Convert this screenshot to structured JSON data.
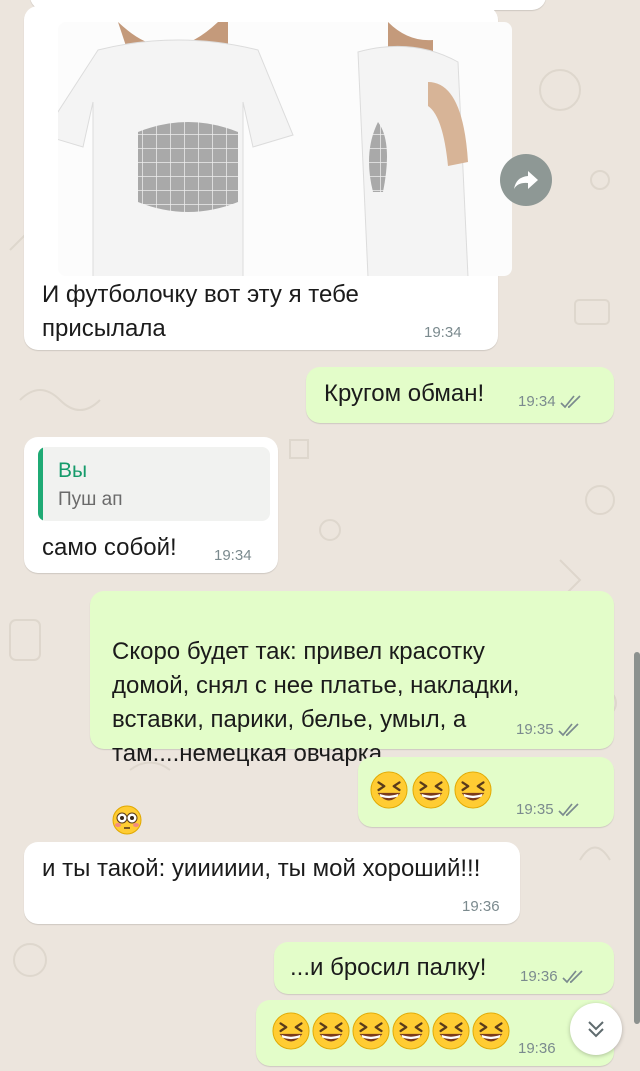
{
  "colors": {
    "background": "#ece5dd",
    "incoming_bubble": "#ffffff",
    "outgoing_bubble": "#e3fdc9",
    "read_ticks": "#7b8a8e",
    "quote_accent": "#1faa74"
  },
  "messages": [
    {
      "id": "m1",
      "direction": "in",
      "type": "image",
      "image": "woman-in-white-t-shirt-with-grid-print",
      "text": "И футболочку вот эту я тебе\nприсылала",
      "time": "19:34"
    },
    {
      "id": "m2",
      "direction": "out",
      "text": "Кругом обман!",
      "time": "19:34",
      "status": "read"
    },
    {
      "id": "m3",
      "direction": "in",
      "reply_to": {
        "author": "Вы",
        "text": "Пуш ап"
      },
      "text": "само собой!",
      "time": "19:34"
    },
    {
      "id": "m4",
      "direction": "out",
      "text": "Скоро будет так: привел красотку\nдомой, снял с нее платье, накладки,\nвставки, парики, белье, умыл, а\nтам....немецкая овчарка",
      "emoji": [
        "flushed-face"
      ],
      "time": "19:35",
      "status": "read"
    },
    {
      "id": "m5",
      "direction": "out",
      "emoji": [
        "laughing-face",
        "laughing-face",
        "laughing-face"
      ],
      "time": "19:35",
      "status": "read"
    },
    {
      "id": "m6",
      "direction": "in",
      "text": "и ты такой: уииииии, ты мой хороший!!!",
      "time": "19:36"
    },
    {
      "id": "m7",
      "direction": "out",
      "text": "...и бросил палку!",
      "time": "19:36",
      "status": "read"
    },
    {
      "id": "m8",
      "direction": "out",
      "emoji": [
        "laughing-face",
        "laughing-face",
        "laughing-face",
        "laughing-face",
        "laughing-face",
        "laughing-face"
      ],
      "time": "19:36"
    }
  ],
  "controls": {
    "forward_icon": "forward-arrow-icon",
    "scroll_down_icon": "double-chevron-down-icon"
  }
}
